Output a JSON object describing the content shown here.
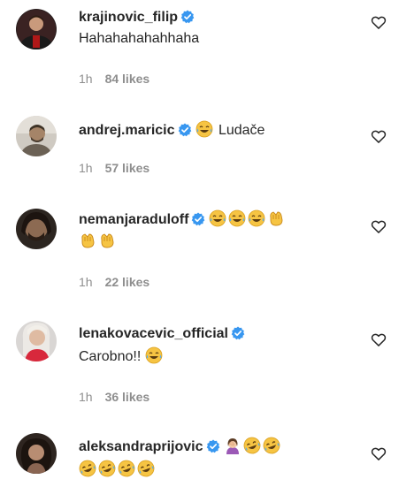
{
  "comments": [
    {
      "username": "krajinovic_filip",
      "text": "Hahahahahahhaha",
      "emojis_inline": [],
      "emojis_line2": [],
      "time": "1h",
      "likes": "84 likes"
    },
    {
      "username": "andrej.maricic",
      "text": "Ludače",
      "emojis_inline": [
        "face-with-tears-of-joy"
      ],
      "emojis_line2": [],
      "time": "1h",
      "likes": "57 likes"
    },
    {
      "username": "nemanjaraduloff",
      "text": "",
      "emojis_inline": [
        "face-with-tears-of-joy",
        "face-with-tears-of-joy",
        "face-with-tears-of-joy",
        "clapping-hands"
      ],
      "emojis_line2": [
        "clapping-hands",
        "clapping-hands"
      ],
      "time": "1h",
      "likes": "22 likes"
    },
    {
      "username": "lenakovacevic_official",
      "text": "Carobno!!",
      "emojis_inline": [
        "face-with-tears-of-joy"
      ],
      "emojis_line2": [],
      "time": "1h",
      "likes": "36 likes"
    },
    {
      "username": "aleksandraprijovic",
      "text": "",
      "emojis_inline": [
        "woman-facepalming",
        "rolling-on-floor-laughing",
        "rolling-on-floor-laughing"
      ],
      "emojis_line2": [
        "rolling-on-floor-laughing",
        "rolling-on-floor-laughing",
        "rolling-on-floor-laughing",
        "rolling-on-floor-laughing"
      ],
      "time": "",
      "likes": ""
    }
  ],
  "colors": {
    "verified_blue": "#3897f0",
    "username_text": "#262626",
    "meta_gray": "#8e8e8e",
    "emoji_yellow": "#f6c443"
  },
  "icons": {
    "verified": "verified-badge-icon",
    "like": "heart-outline-icon"
  }
}
